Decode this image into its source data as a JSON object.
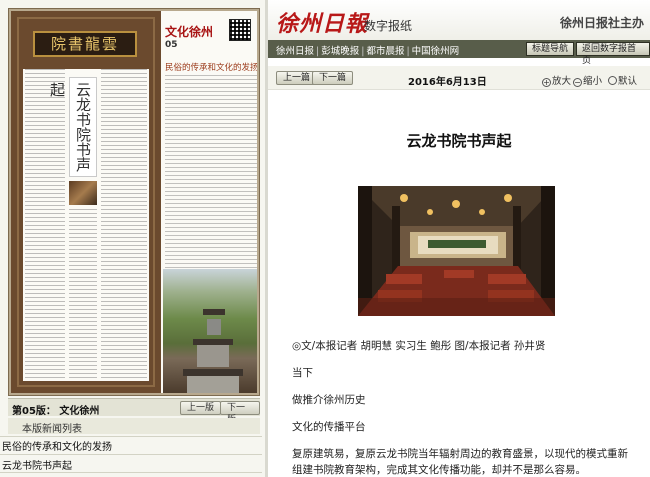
{
  "left_panel": {
    "plaque_text": "院書龍雲",
    "vertical_title": "云龙书院书声起",
    "newspaper_logo": "文化徐州",
    "newspaper_page_no": "05",
    "newspaper_headline": "民俗的传承和文化的发扬",
    "page_label": "第05版： 文化徐州",
    "prev_page": "上一版",
    "next_page": "下一版",
    "list_title": "本版新闻列表",
    "news_items": [
      "民俗的传承和文化的发扬",
      "云龙书院书声起"
    ]
  },
  "header": {
    "brand_logo": "徐州日報",
    "brand_sub": "数字报纸",
    "sponsor": "徐州日报社主办",
    "menu_links": [
      "徐州日报",
      "彭城晚报",
      "都市晨报",
      "中国徐州网"
    ],
    "nav_button": "标题导航",
    "home_button": "返回数字报首页"
  },
  "toolbar": {
    "prev_article": "上一篇",
    "next_article": "下一篇",
    "date": "2016年6月13日",
    "zoom_in": "放大",
    "zoom_out": "缩小",
    "zoom_default": "默认"
  },
  "article": {
    "title": "云龙书院书声起",
    "byline": "◎文/本报记者 胡明慧 实习生 鲍彤 图/本报记者 孙井贤",
    "paragraphs": [
      "当下",
      "做推介徐州历史",
      "文化的传播平台",
      "复原建筑易，复原云龙书院当年辐射周边的教育盛景，以现代的模式重新组建书院教育架构，完成其文化传播功能，却并不是那么容易。"
    ]
  },
  "colors": {
    "brand_red": "#b81818",
    "menubar": "#585d4a",
    "frame_wood": "#6b4a2e"
  }
}
